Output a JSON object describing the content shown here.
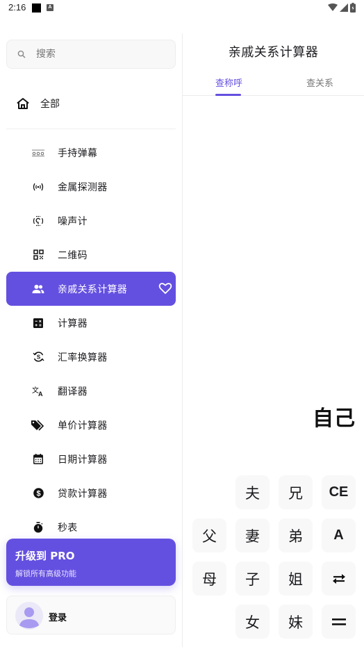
{
  "status_bar": {
    "time": "2:16",
    "notification_icons": [
      "black-square-icon",
      "a-badge-icon"
    ],
    "system_icons": [
      "wifi-icon",
      "signal-icon",
      "battery-charging-icon"
    ],
    "a_badge": "A"
  },
  "sidebar": {
    "search": {
      "placeholder": "搜索",
      "value": ""
    },
    "all_label": "全部",
    "items": [
      {
        "label": "手持弹幕",
        "icon": "marquee-icon"
      },
      {
        "label": "金属探测器",
        "icon": "sensor-icon"
      },
      {
        "label": "噪声计",
        "icon": "noise-icon"
      },
      {
        "label": "二维码",
        "icon": "qr-code-icon"
      },
      {
        "label": "亲戚关系计算器",
        "icon": "people-icon",
        "active": true,
        "favorite_icon": "heart-outline-icon"
      },
      {
        "label": "计算器",
        "icon": "calculator-icon"
      },
      {
        "label": "汇率换算器",
        "icon": "currency-exchange-icon"
      },
      {
        "label": "翻译器",
        "icon": "translate-icon"
      },
      {
        "label": "单价计算器",
        "icon": "tags-icon"
      },
      {
        "label": "日期计算器",
        "icon": "calendar-icon"
      },
      {
        "label": "贷款计算器",
        "icon": "dollar-circle-icon"
      },
      {
        "label": "秒表",
        "icon": "stopwatch-icon"
      }
    ],
    "pro": {
      "title": "升级到 PRO",
      "subtitle": "解锁所有高级功能"
    },
    "login": {
      "label": "登录"
    }
  },
  "main": {
    "title": "亲戚关系计算器",
    "tabs": [
      {
        "label": "查称呼",
        "active": true
      },
      {
        "label": "查关系",
        "active": false
      }
    ],
    "result": "自己",
    "keys": [
      {
        "label": "夫",
        "row": 0,
        "col": 1
      },
      {
        "label": "兄",
        "row": 0,
        "col": 2
      },
      {
        "label": "CE",
        "row": 0,
        "col": 3,
        "latin": true
      },
      {
        "label": "父",
        "row": 1,
        "col": 0
      },
      {
        "label": "妻",
        "row": 1,
        "col": 1
      },
      {
        "label": "弟",
        "row": 1,
        "col": 2
      },
      {
        "label": "A",
        "row": 1,
        "col": 3,
        "latin": true
      },
      {
        "label": "母",
        "row": 2,
        "col": 0
      },
      {
        "label": "子",
        "row": 2,
        "col": 1
      },
      {
        "label": "姐",
        "row": 2,
        "col": 2
      },
      {
        "label": "",
        "row": 2,
        "col": 3,
        "icon": "swap-icon"
      },
      {
        "label": "女",
        "row": 3,
        "col": 1
      },
      {
        "label": "妹",
        "row": 3,
        "col": 2
      },
      {
        "label": "",
        "row": 3,
        "col": 3,
        "icon": "equals-icon"
      }
    ]
  },
  "colors": {
    "accent": "#6450e0",
    "key_bg": "#f8f8f8",
    "text": "#1c1b1f",
    "muted": "#9e9e9e"
  }
}
